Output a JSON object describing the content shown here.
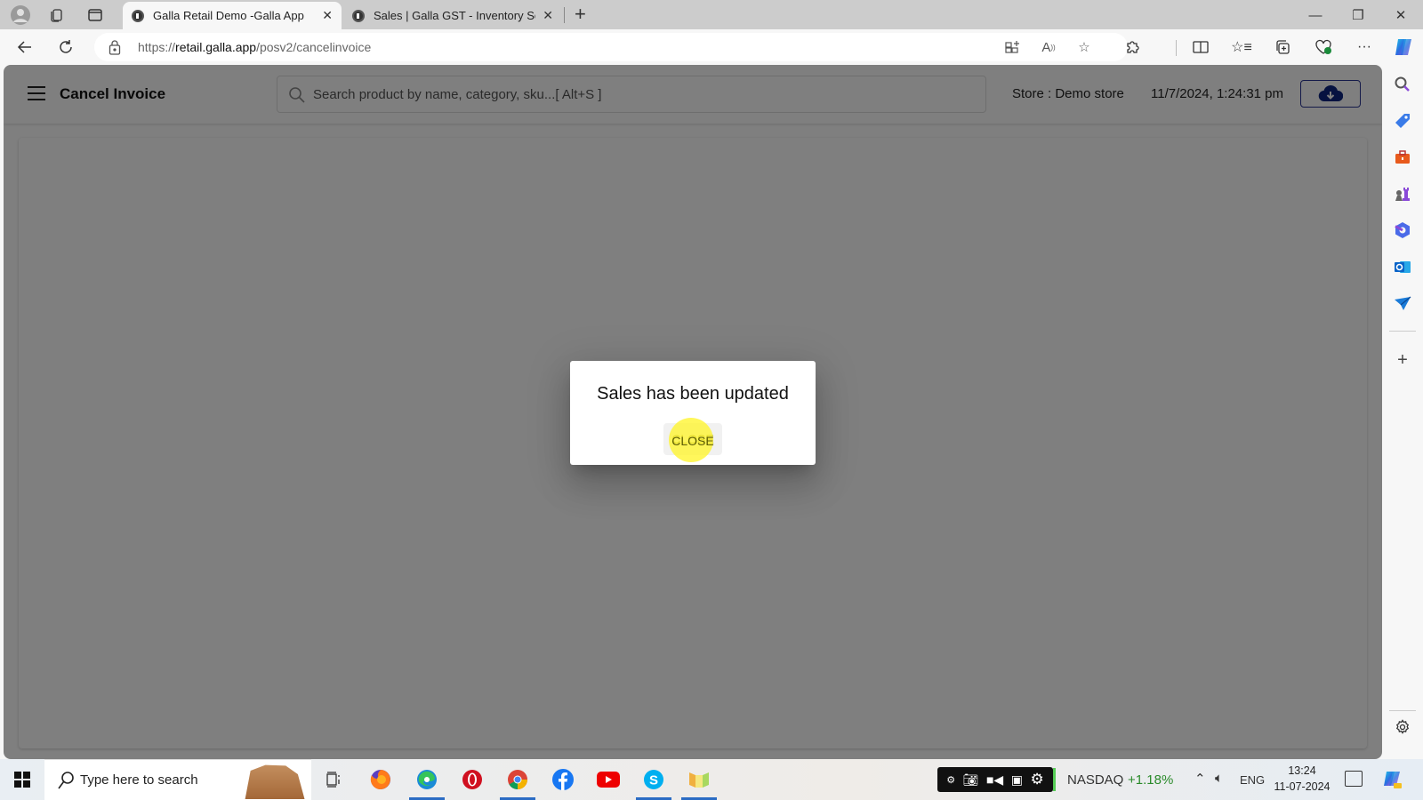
{
  "browser": {
    "tabs": [
      {
        "title": "Galla Retail Demo -Galla App",
        "active": true
      },
      {
        "title": "Sales | Galla GST - Inventory Soft",
        "active": false
      }
    ],
    "new_tab_label": "+",
    "url_prefix": "https://",
    "url_host": "retail.galla.app",
    "url_path": "/posv2/cancelinvoice",
    "window_controls": {
      "minimize": "—",
      "maximize": "❐",
      "close": "✕"
    }
  },
  "edge_sidebar": {
    "items": [
      "search-icon",
      "shopping-tag-icon",
      "tools-icon",
      "games-icon",
      "microsoft365-icon",
      "outlook-icon",
      "send-icon"
    ],
    "add_label": "+"
  },
  "app": {
    "header": {
      "title": "Cancel Invoice",
      "search_placeholder": "Search product by name, category, sku...[ Alt+S ]",
      "search_value": "",
      "store_label": "Store : Demo store",
      "datetime": "11/7/2024, 1:24:31 pm",
      "sync_icon": "cloud-download-icon"
    },
    "dialog": {
      "message": "Sales has been updated",
      "close_label": "CLOSE"
    }
  },
  "taskbar": {
    "search_placeholder": "Type here to search",
    "apps": [
      "task-view",
      "firefox",
      "edge",
      "opera",
      "chrome",
      "facebook",
      "youtube",
      "skype",
      "app"
    ],
    "ticker_name": "NASDAQ",
    "ticker_change": "+1.18%",
    "language": "ENG",
    "time": "13:24",
    "date": "11-07-2024"
  }
}
